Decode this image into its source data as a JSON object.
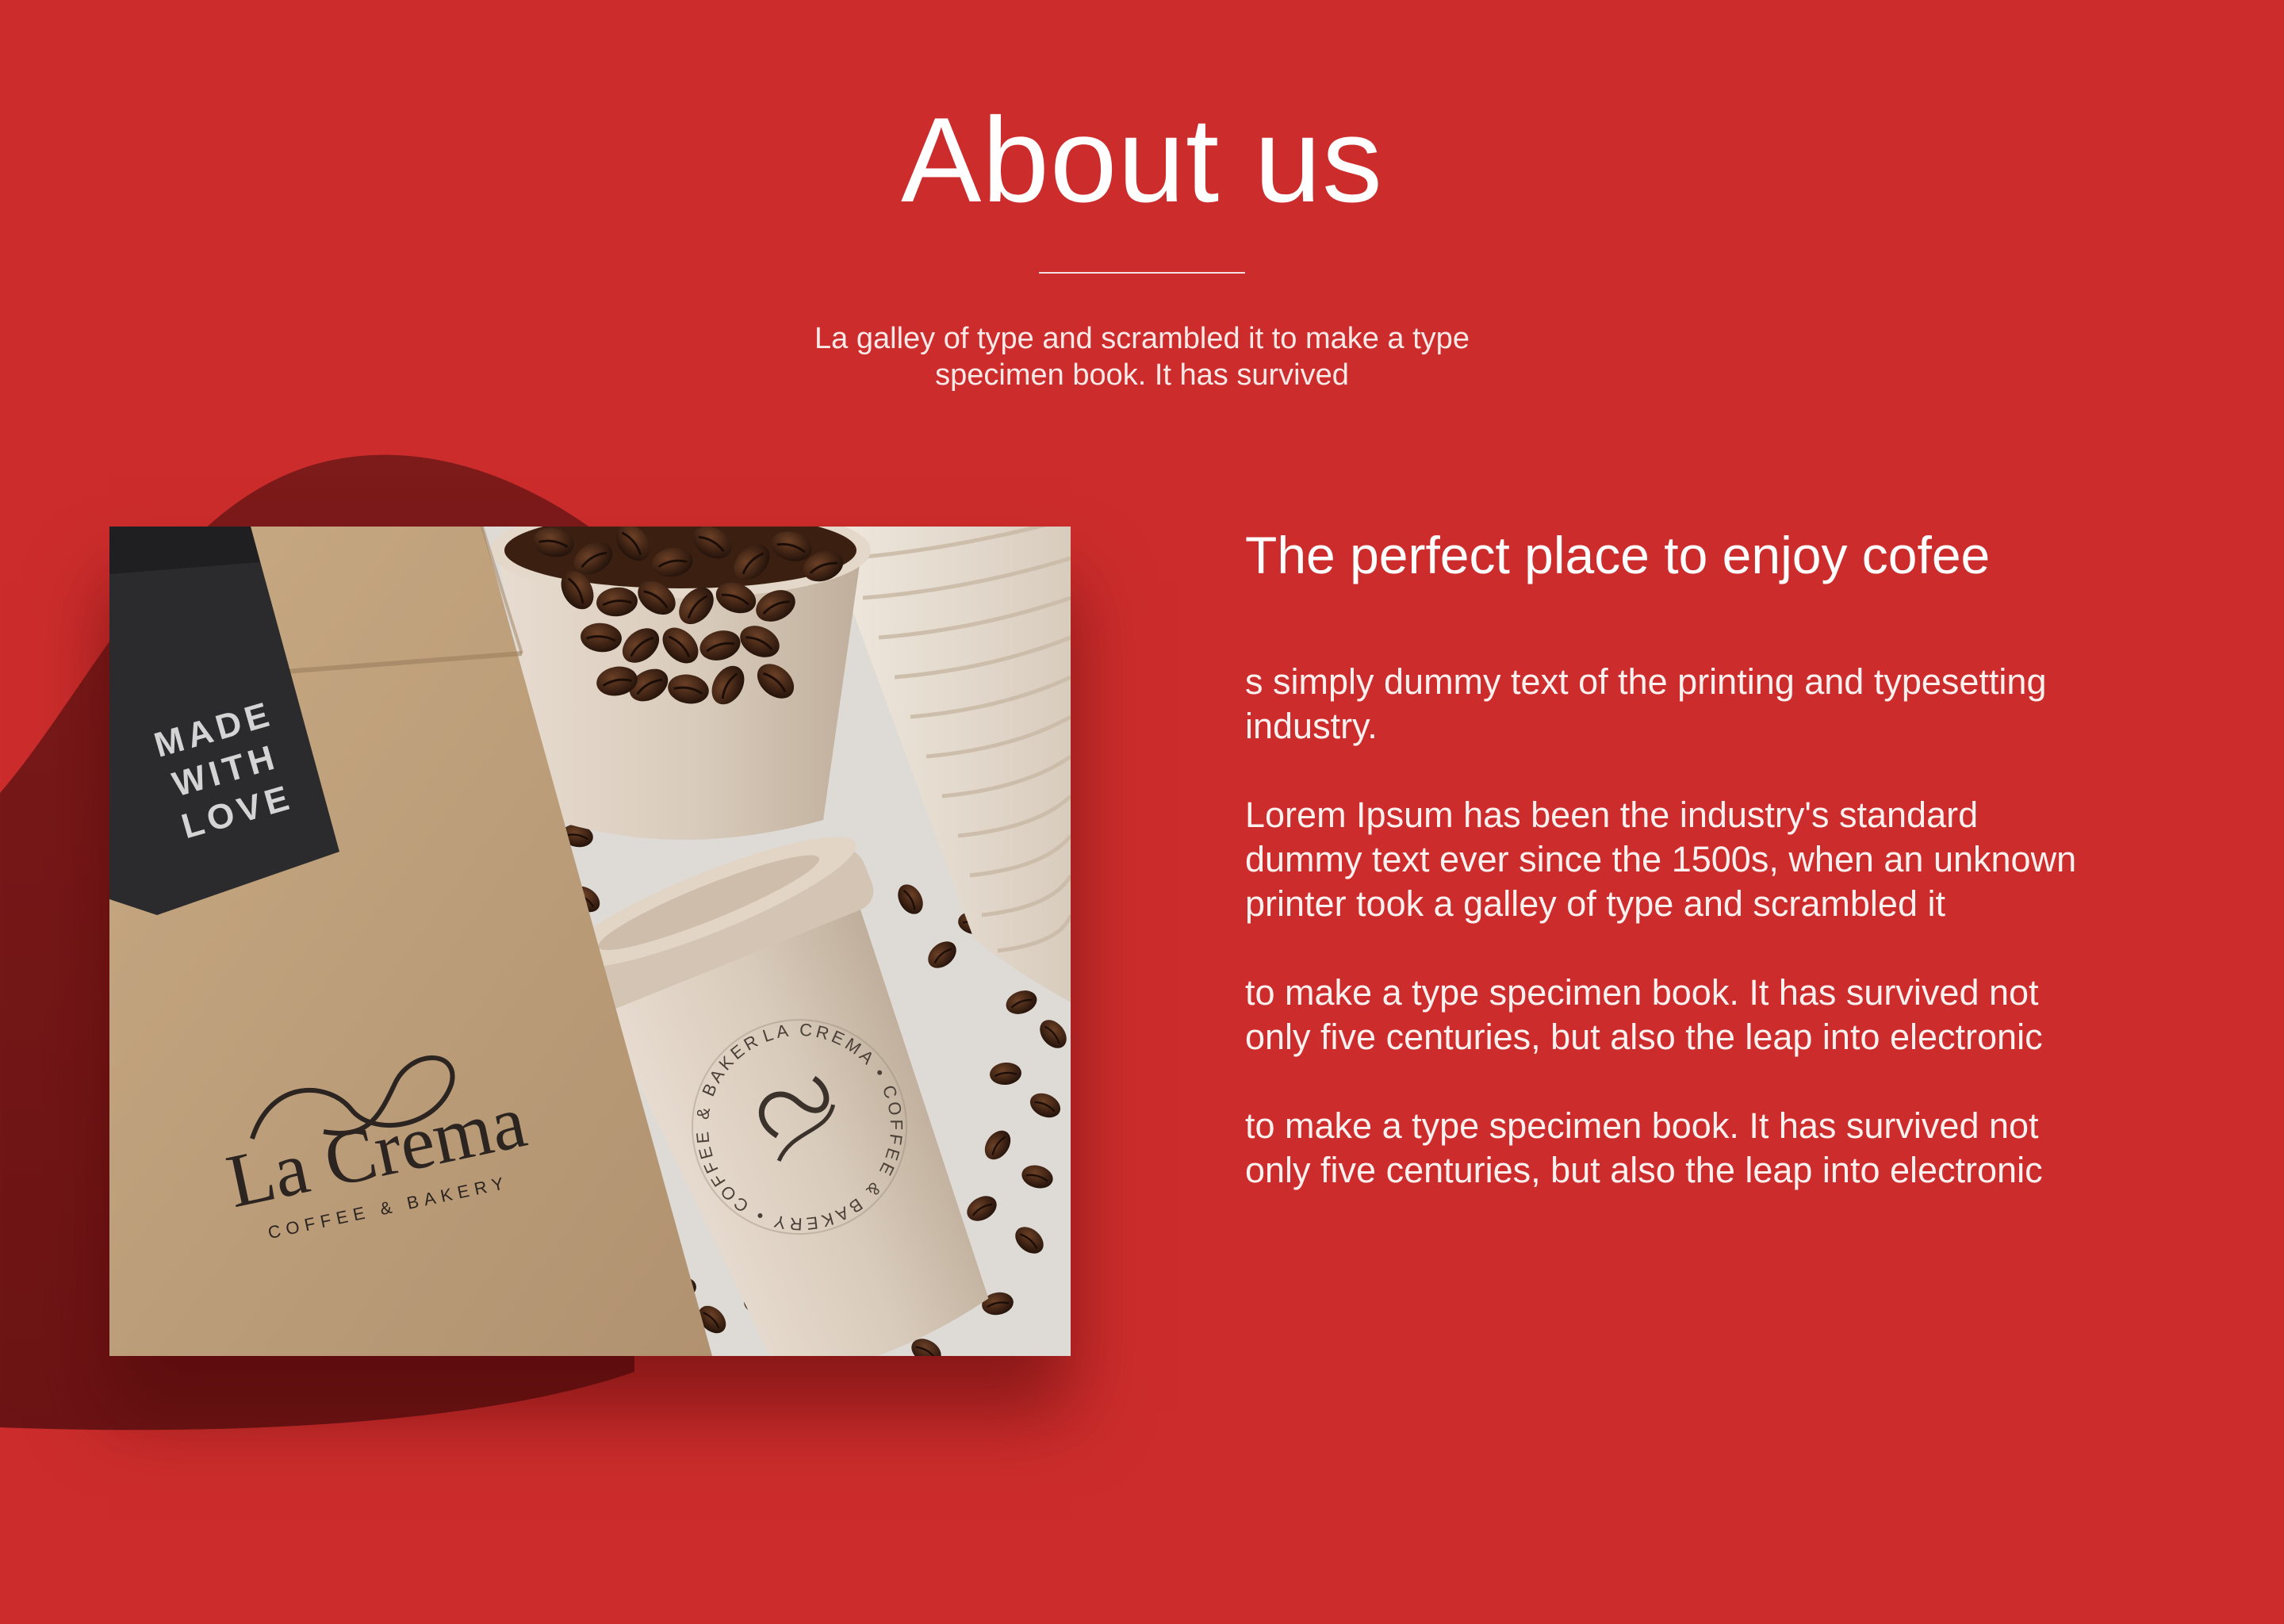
{
  "header": {
    "title": "About us",
    "intro_lines": [
      "La galley of type and scrambled it to make a type",
      "specimen book. It has survived"
    ]
  },
  "photo": {
    "description_icon": "coffee-bag-and-cup-photo",
    "label_lines": [
      "MADE",
      "WITH",
      "LOVE"
    ],
    "brand": "La Crema",
    "brand_tagline": "COFFEE & BAKERY",
    "cup_ring_text": "LA CREMA • COFFEE & BAKERY • COFFEE & BAKERY •"
  },
  "content": {
    "heading": "The perfect place to enjoy cofee",
    "paragraphs": [
      {
        "lines": [
          "s simply dummy text of the printing and typesetting",
          "industry."
        ]
      },
      {
        "lines": [
          "Lorem Ipsum has been the industry's standard",
          "dummy text ever since the 1500s, when an unknown",
          "printer took a galley of type and scrambled it"
        ]
      },
      {
        "lines": [
          "to make a type specimen book. It has survived not",
          "only five centuries, but also the leap into electronic"
        ]
      },
      {
        "lines": [
          "to make a type specimen book. It has survived not",
          "only five centuries, but also the leap into electronic"
        ]
      }
    ]
  },
  "colors": {
    "background": "#cc2d2c",
    "blob": "#7a1718",
    "text": "#ffffff"
  }
}
